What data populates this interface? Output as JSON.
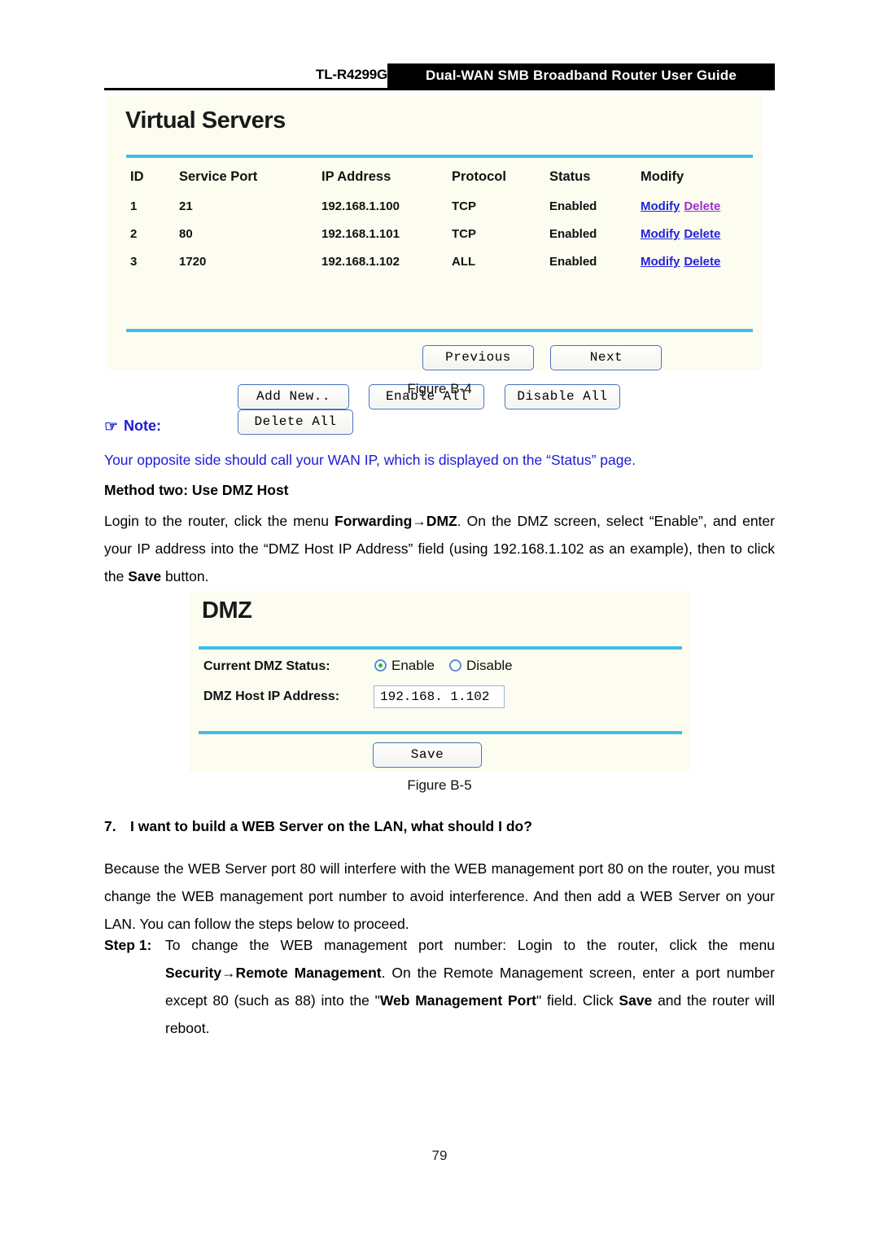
{
  "header": {
    "model": "TL-R4299G",
    "title": "Dual-WAN SMB Broadband Router User Guide"
  },
  "virtual_servers": {
    "panel_title": "Virtual Servers",
    "columns": [
      "ID",
      "Service Port",
      "IP Address",
      "Protocol",
      "Status",
      "Modify"
    ],
    "rows": [
      {
        "id": "1",
        "service_port": "21",
        "ip_address": "192.168.1.100",
        "protocol": "TCP",
        "status": "Enabled",
        "modify": "Modify",
        "delete": "Delete"
      },
      {
        "id": "2",
        "service_port": "80",
        "ip_address": "192.168.1.101",
        "protocol": "TCP",
        "status": "Enabled",
        "modify": "Modify",
        "delete": "Delete"
      },
      {
        "id": "3",
        "service_port": "1720",
        "ip_address": "192.168.1.102",
        "protocol": "ALL",
        "status": "Enabled",
        "modify": "Modify",
        "delete": "Delete"
      }
    ],
    "buttons": {
      "add_new": "Add New..",
      "enable_all": "Enable All",
      "disable_all": "Disable All",
      "delete_all": "Delete All",
      "previous": "Previous",
      "next": "Next"
    },
    "link_color": "#2222dd",
    "visited_link_color": "#9b2fcf",
    "divider_color": "#3fbdeb",
    "panel_background": "#fcfcf0"
  },
  "figure_b4_caption": "Figure B-4",
  "note": {
    "icon": "pointing-hand-icon",
    "glyph": "☞",
    "label": "Note:",
    "text": "Your opposite side should call your WAN IP, which is displayed on the “Status” page.",
    "color": "#1b1bd6"
  },
  "method_two": {
    "heading": "Method two: Use DMZ Host",
    "body_part1": "Login to the router, click the menu ",
    "body_bold1": "Forwarding→DMZ",
    "body_part2": ". On the DMZ screen, select “Enable”, and enter your IP address into the “DMZ Host IP Address” field (using 192.168.1.102 as an example), then to click the ",
    "body_bold2": "Save",
    "body_part3": " button."
  },
  "dmz": {
    "panel_title": "DMZ",
    "status_label": "Current DMZ Status:",
    "enable_label": "Enable",
    "disable_label": "Disable",
    "selected_status": "Enable",
    "ip_label": "DMZ Host IP Address:",
    "ip_value": "192.168. 1.102",
    "save_label": "Save"
  },
  "figure_b5_caption": "Figure B-5",
  "question7": {
    "number": "7.",
    "heading": "I want to build a WEB Server on the LAN, what should I do?",
    "body": "Because the WEB Server port 80 will interfere with the WEB management port 80 on the router, you must change the WEB management port number to avoid interference. And then add a WEB Server on your LAN. You can follow the steps below to proceed."
  },
  "step1": {
    "label": "Step 1:",
    "text_part1": "To change the WEB management port number: Login to the router, click the menu ",
    "bold1": "Security→Remote Management",
    "text_part2": ". On the Remote Management screen, enter a port number except 80 (such as 88) into the \"",
    "bold2": "Web Management Port",
    "text_part3": "\" field. Click ",
    "bold3": "Save",
    "text_part4": " and the router will reboot."
  },
  "page_number": "79"
}
